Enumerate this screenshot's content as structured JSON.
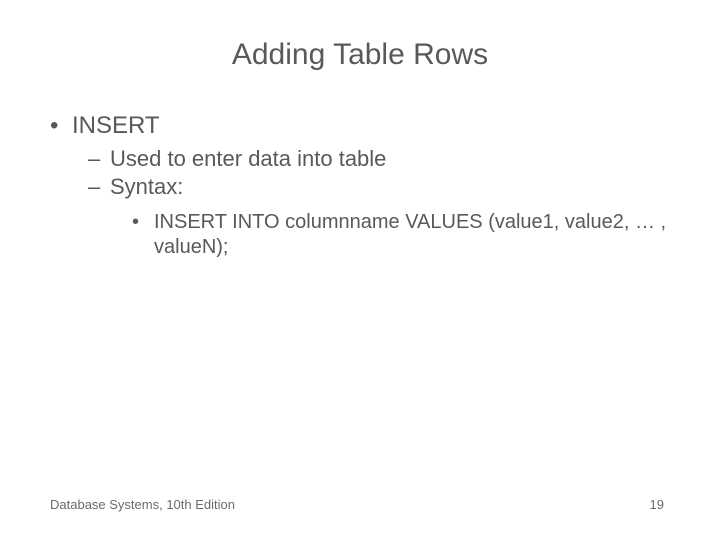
{
  "slide": {
    "title": "Adding Table Rows",
    "bullets": {
      "l1": "INSERT",
      "l2a": "Used to enter data into table",
      "l2b": "Syntax:",
      "l3": "INSERT INTO columnname VALUES (value1, value2, … , valueN);"
    },
    "footer": {
      "left": "Database Systems, 10th Edition",
      "pageNumber": "19"
    }
  }
}
